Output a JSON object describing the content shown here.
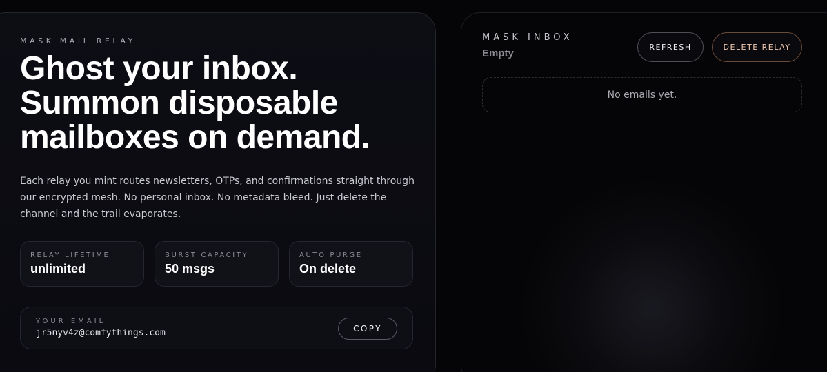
{
  "relay": {
    "eyebrow": "MASK MAIL RELAY",
    "headline": [
      "Ghost your inbox.",
      "Summon disposable",
      "mailboxes on demand."
    ],
    "description": "Each relay you mint routes newsletters, OTPs, and confirmations straight through our encrypted mesh. No personal inbox. No metadata bleed. Just delete the channel and the trail evaporates.",
    "stats": [
      {
        "label": "RELAY LIFETIME",
        "value": "unlimited"
      },
      {
        "label": "BURST CAPACITY",
        "value": "50 msgs"
      },
      {
        "label": "AUTO PURGE",
        "value": "On delete"
      }
    ],
    "email": {
      "label": "YOUR EMAIL",
      "address": "jr5nyv4z@comfythings.com",
      "copy_label": "COPY"
    }
  },
  "inbox": {
    "title": "MASK INBOX",
    "status": "Empty",
    "refresh_label": "REFRESH",
    "delete_label": "DELETE RELAY",
    "empty_message": "No emails yet."
  },
  "colors": {
    "background": "#050507",
    "card": "#0d0d14",
    "accent_delete": "#f0c9b0"
  }
}
